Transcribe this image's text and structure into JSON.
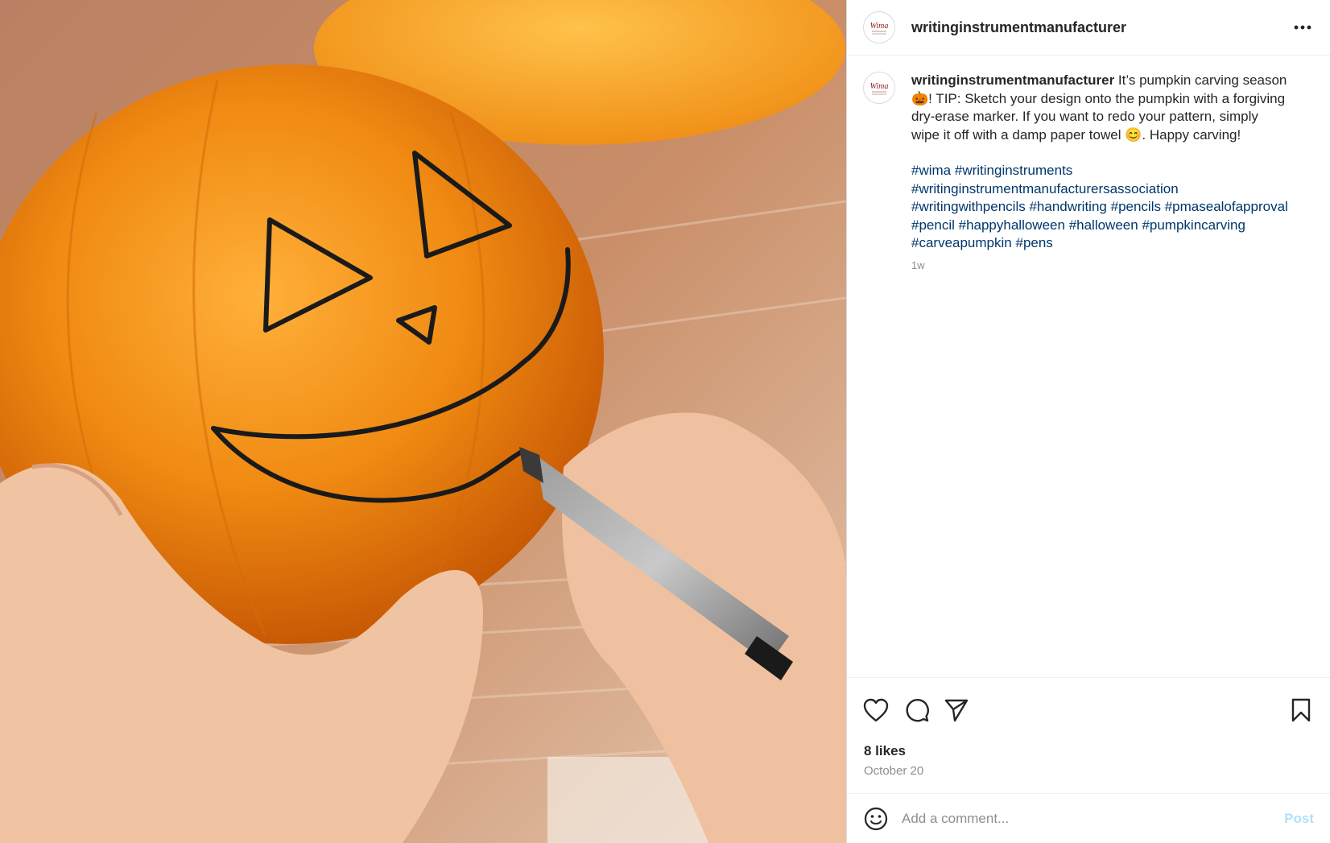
{
  "photo": {
    "description_icon": "pumpkin-carving-photo"
  },
  "header": {
    "username": "writinginstrumentmanufacturer",
    "more_icon": "more-horizontal-icon"
  },
  "caption": {
    "username": "writinginstrumentmanufacturer",
    "text": " It’s pumpkin carving season 🎃! TIP: Sketch your design onto the pumpkin with a forgiving dry-erase marker. If you want to redo your pattern, simply wipe it off with a damp paper towel 😊. Happy carving!",
    "hashtags": [
      "#wima",
      "#writinginstruments",
      "#writinginstrumentmanufacturersassociation",
      "#writingwithpencils",
      "#handwriting",
      "#pencils",
      "#pmasealofapproval",
      "#pencil",
      "#happyhalloween",
      "#halloween",
      "#pumpkincarving",
      "#carveapumpkin",
      "#pens"
    ],
    "time": "1w"
  },
  "actions": {
    "like_icon": "heart-icon",
    "comment_icon": "comment-icon",
    "share_icon": "send-icon",
    "save_icon": "bookmark-icon"
  },
  "likes": "8 likes",
  "date": "October 20",
  "comment": {
    "placeholder": "Add a comment...",
    "post_label": "Post",
    "emoji_icon": "emoji-icon"
  },
  "colors": {
    "link": "#00376b",
    "muted": "#8e8e8e",
    "post_disabled": "#b2dffc",
    "text": "#262626"
  }
}
